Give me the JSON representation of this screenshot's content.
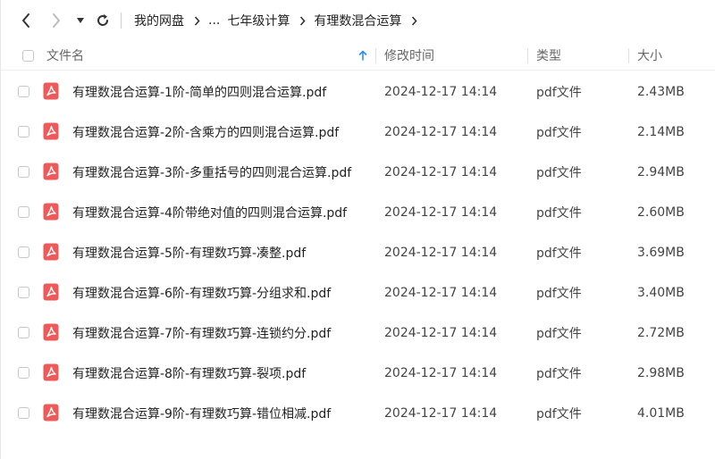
{
  "nav": {
    "breadcrumbs": [
      "我的网盘",
      "...",
      "七年级计算",
      "有理数混合运算"
    ]
  },
  "header": {
    "name": "文件名",
    "modified": "修改时间",
    "type": "类型",
    "size": "大小",
    "sort_icon": "arrow-up-icon"
  },
  "files": [
    {
      "name": "有理数混合运算-1阶-简单的四则混合运算.pdf",
      "modified": "2024-12-17 14:14",
      "type": "pdf文件",
      "size": "2.43MB"
    },
    {
      "name": "有理数混合运算-2阶-含乘方的四则混合运算.pdf",
      "modified": "2024-12-17 14:14",
      "type": "pdf文件",
      "size": "2.14MB"
    },
    {
      "name": "有理数混合运算-3阶-多重括号的四则混合运算.pdf",
      "modified": "2024-12-17 14:14",
      "type": "pdf文件",
      "size": "2.94MB"
    },
    {
      "name": "有理数混合运算-4阶带绝对值的四则混合运算.pdf",
      "modified": "2024-12-17 14:14",
      "type": "pdf文件",
      "size": "2.60MB"
    },
    {
      "name": "有理数混合运算-5阶-有理数巧算-凑整.pdf",
      "modified": "2024-12-17 14:14",
      "type": "pdf文件",
      "size": "3.69MB"
    },
    {
      "name": "有理数混合运算-6阶-有理数巧算-分组求和.pdf",
      "modified": "2024-12-17 14:14",
      "type": "pdf文件",
      "size": "3.40MB"
    },
    {
      "name": "有理数混合运算-7阶-有理数巧算-连锁约分.pdf",
      "modified": "2024-12-17 14:14",
      "type": "pdf文件",
      "size": "2.72MB"
    },
    {
      "name": "有理数混合运算-8阶-有理数巧算-裂项.pdf",
      "modified": "2024-12-17 14:14",
      "type": "pdf文件",
      "size": "2.98MB"
    },
    {
      "name": "有理数混合运算-9阶-有理数巧算-错位相减.pdf",
      "modified": "2024-12-17 14:14",
      "type": "pdf文件",
      "size": "4.01MB"
    }
  ],
  "colors": {
    "pdf_icon": "#ee5a5a",
    "sort_arrow": "#2f8cff"
  }
}
